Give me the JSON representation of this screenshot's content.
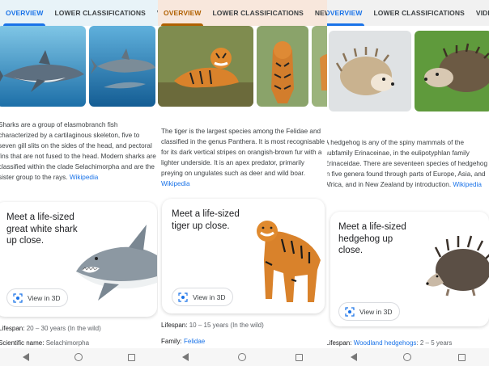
{
  "tabs": {
    "overview": "OVERVIEW",
    "lower": "LOWER CLASSIFICATIONS",
    "videos_partial": "VIDEOS",
    "news": "NEWS",
    "video_partial_3": "VIDEO"
  },
  "shark": {
    "description": "Sharks are a group of elasmobranch fish characterized by a cartilaginous skeleton, five to seven gill slits on the sides of the head, and pectoral fins that are not fused to the head. Modern sharks are classified within the clade Selachimorpha and are the sister group to the rays.",
    "source": "Wikipedia",
    "card_title": "Meet a life-sized great white shark up close.",
    "view3d": "View in 3D",
    "lifespan_label": "Lifespan:",
    "lifespan_value": "20 – 30 years (In the wild)",
    "sci_label": "Scientific name:",
    "sci_value": "Selachimorpha"
  },
  "tiger": {
    "description": "The tiger is the largest species among the Felidae and classified in the genus Panthera. It is most recognisable for its dark vertical stripes on orangish-brown fur with a lighter underside. It is an apex predator, primarily preying on ungulates such as deer and wild boar.",
    "source": "Wikipedia",
    "card_title": "Meet a life-sized tiger up close.",
    "view3d": "View in 3D",
    "lifespan_label": "Lifespan:",
    "lifespan_value": "10 – 15 years (In the wild)",
    "family_label": "Family:",
    "family_value": "Felidae"
  },
  "hedgehog": {
    "description": "A hedgehog is any of the spiny mammals of the subfamily Erinaceinae, in the eulipotyphlan family Erinaceidae. There are seventeen species of hedgehog in five genera found through parts of Europe, Asia, and Africa, and in New Zealand by introduction.",
    "source": "Wikipedia",
    "card_title": "Meet a life-sized hedgehog up close.",
    "view3d": "View in 3D",
    "lifespan_label": "Lifespan:",
    "lifespan_value_link": "Woodland hedgehogs",
    "lifespan_value_rest": ": 2 – 5 years"
  },
  "icons": {
    "view3d": "ar-cube-icon",
    "nav": [
      "back-icon",
      "home-icon",
      "recents-icon"
    ]
  },
  "colors": {
    "link": "#1a73e8",
    "shark_tabbar": "#e8f3f8",
    "tiger_tabbar": "#f8e7dc",
    "tiger_accent": "#b06000"
  }
}
